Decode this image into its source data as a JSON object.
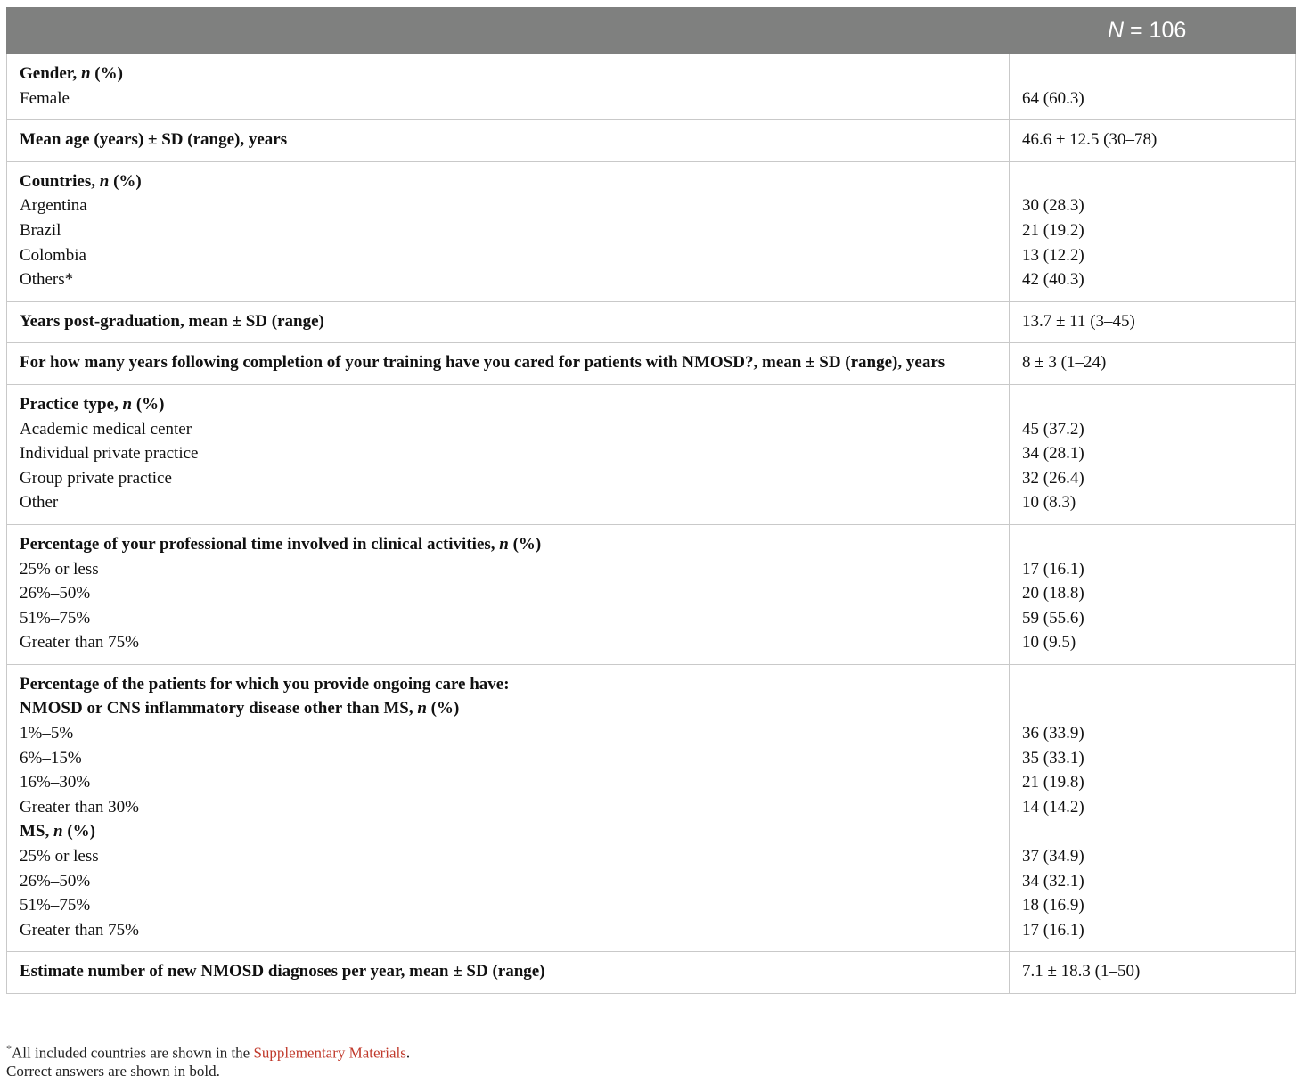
{
  "header": {
    "n_label": "N",
    "n_value": " = 106"
  },
  "rows": [
    {
      "label_lines": [
        {
          "text": "Gender, ",
          "ital": "n",
          "tail": " (%)",
          "bold": true
        },
        {
          "text": "Female",
          "bold": false
        }
      ],
      "values": [
        "",
        "64 (60.3)"
      ]
    },
    {
      "label_lines": [
        {
          "text": "Mean age (years) ± SD (range), years",
          "bold": true
        }
      ],
      "values": [
        "46.6 ± 12.5 (30–78)"
      ]
    },
    {
      "label_lines": [
        {
          "text": "Countries, ",
          "ital": "n",
          "tail": " (%)",
          "bold": true
        },
        {
          "text": "Argentina"
        },
        {
          "text": "Brazil"
        },
        {
          "text": "Colombia"
        },
        {
          "text": "Others*"
        }
      ],
      "values": [
        "",
        "30 (28.3)",
        "21 (19.2)",
        "13 (12.2)",
        "42 (40.3)"
      ]
    },
    {
      "label_lines": [
        {
          "text": "Years post-graduation, mean ± SD (range)",
          "bold": true
        }
      ],
      "values": [
        "13.7 ± 11 (3–45)"
      ]
    },
    {
      "label_lines": [
        {
          "text": "For how many years following completion of your training have you cared for patients with NMOSD?, mean ± SD (range), years",
          "bold": true,
          "wrap": true
        }
      ],
      "values": [
        "8 ± 3 (1–24)"
      ]
    },
    {
      "label_lines": [
        {
          "text": "Practice type, ",
          "ital": "n",
          "tail": " (%)",
          "bold": true
        },
        {
          "text": "Academic medical center"
        },
        {
          "text": "Individual private practice"
        },
        {
          "text": "Group private practice"
        },
        {
          "text": "Other"
        }
      ],
      "values": [
        "",
        "45 (37.2)",
        "34 (28.1)",
        "32 (26.4)",
        "10 (8.3)"
      ]
    },
    {
      "label_lines": [
        {
          "text": "Percentage of your professional time involved in clinical activities, ",
          "ital": "n",
          "tail": " (%)",
          "bold": true
        },
        {
          "text": "25% or less"
        },
        {
          "text": "26%–50%"
        },
        {
          "text": "51%–75%"
        },
        {
          "text": "Greater than 75%"
        }
      ],
      "values": [
        "",
        "17 (16.1)",
        "20 (18.8)",
        "59 (55.6)",
        "10 (9.5)"
      ]
    },
    {
      "label_lines": [
        {
          "text": "Percentage of the patients for which you provide ongoing care have:",
          "bold": true
        },
        {
          "text": "NMOSD or CNS inflammatory disease other than MS, ",
          "ital": "n",
          "tail": " (%)",
          "bold": true
        },
        {
          "text": "1%–5%"
        },
        {
          "text": "6%–15%"
        },
        {
          "text": "16%–30%"
        },
        {
          "text": "Greater than 30%"
        },
        {
          "text": "MS, ",
          "ital": "n",
          "tail": " (%)",
          "bold": true
        },
        {
          "text": "25% or less"
        },
        {
          "text": "26%–50%"
        },
        {
          "text": "51%–75%"
        },
        {
          "text": "Greater than 75%"
        }
      ],
      "values": [
        "",
        "",
        "36 (33.9)",
        "35 (33.1)",
        "21 (19.8)",
        "14 (14.2)",
        "",
        "37 (34.9)",
        "34 (32.1)",
        "18 (16.9)",
        "17 (16.1)"
      ]
    },
    {
      "label_lines": [
        {
          "text": "Estimate number of new NMOSD diagnoses per year, mean ± SD (range)",
          "bold": true
        }
      ],
      "values": [
        "7.1 ± 18.3 (1–50)"
      ]
    }
  ],
  "footnotes": {
    "note1_mark": "*",
    "note1_pre": "All included countries are shown in the ",
    "note1_link": "Supplementary Materials",
    "note1_post": ".",
    "note2": "Correct answers are shown in bold."
  }
}
